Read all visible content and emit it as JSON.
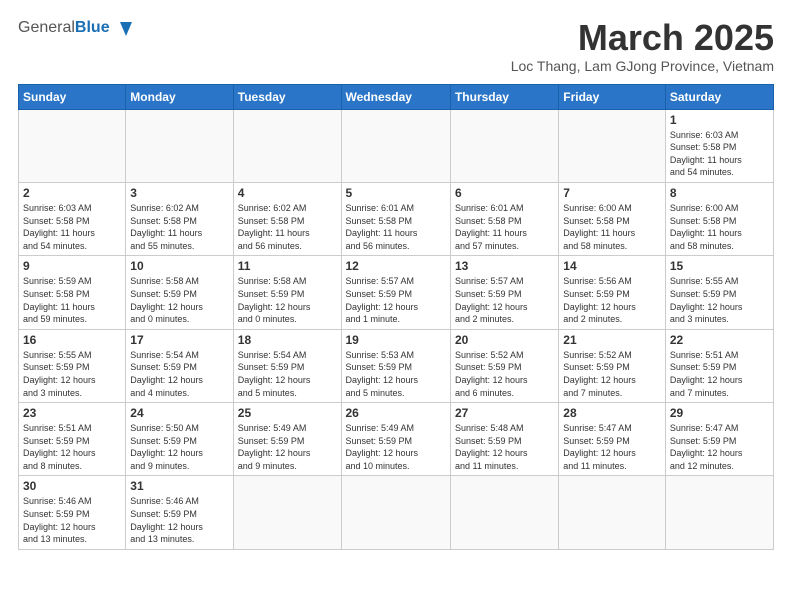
{
  "header": {
    "logo_general": "General",
    "logo_blue": "Blue",
    "month_title": "March 2025",
    "subtitle": "Loc Thang, Lam GJong Province, Vietnam"
  },
  "weekdays": [
    "Sunday",
    "Monday",
    "Tuesday",
    "Wednesday",
    "Thursday",
    "Friday",
    "Saturday"
  ],
  "weeks": [
    [
      {
        "day": null,
        "info": null
      },
      {
        "day": null,
        "info": null
      },
      {
        "day": null,
        "info": null
      },
      {
        "day": null,
        "info": null
      },
      {
        "day": null,
        "info": null
      },
      {
        "day": null,
        "info": null
      },
      {
        "day": "1",
        "info": "Sunrise: 6:03 AM\nSunset: 5:58 PM\nDaylight: 11 hours\nand 54 minutes."
      }
    ],
    [
      {
        "day": "2",
        "info": "Sunrise: 6:03 AM\nSunset: 5:58 PM\nDaylight: 11 hours\nand 54 minutes."
      },
      {
        "day": "3",
        "info": "Sunrise: 6:02 AM\nSunset: 5:58 PM\nDaylight: 11 hours\nand 55 minutes."
      },
      {
        "day": "4",
        "info": "Sunrise: 6:02 AM\nSunset: 5:58 PM\nDaylight: 11 hours\nand 56 minutes."
      },
      {
        "day": "5",
        "info": "Sunrise: 6:01 AM\nSunset: 5:58 PM\nDaylight: 11 hours\nand 56 minutes."
      },
      {
        "day": "6",
        "info": "Sunrise: 6:01 AM\nSunset: 5:58 PM\nDaylight: 11 hours\nand 57 minutes."
      },
      {
        "day": "7",
        "info": "Sunrise: 6:00 AM\nSunset: 5:58 PM\nDaylight: 11 hours\nand 58 minutes."
      },
      {
        "day": "8",
        "info": "Sunrise: 6:00 AM\nSunset: 5:58 PM\nDaylight: 11 hours\nand 58 minutes."
      }
    ],
    [
      {
        "day": "9",
        "info": "Sunrise: 5:59 AM\nSunset: 5:58 PM\nDaylight: 11 hours\nand 59 minutes."
      },
      {
        "day": "10",
        "info": "Sunrise: 5:58 AM\nSunset: 5:59 PM\nDaylight: 12 hours\nand 0 minutes."
      },
      {
        "day": "11",
        "info": "Sunrise: 5:58 AM\nSunset: 5:59 PM\nDaylight: 12 hours\nand 0 minutes."
      },
      {
        "day": "12",
        "info": "Sunrise: 5:57 AM\nSunset: 5:59 PM\nDaylight: 12 hours\nand 1 minute."
      },
      {
        "day": "13",
        "info": "Sunrise: 5:57 AM\nSunset: 5:59 PM\nDaylight: 12 hours\nand 2 minutes."
      },
      {
        "day": "14",
        "info": "Sunrise: 5:56 AM\nSunset: 5:59 PM\nDaylight: 12 hours\nand 2 minutes."
      },
      {
        "day": "15",
        "info": "Sunrise: 5:55 AM\nSunset: 5:59 PM\nDaylight: 12 hours\nand 3 minutes."
      }
    ],
    [
      {
        "day": "16",
        "info": "Sunrise: 5:55 AM\nSunset: 5:59 PM\nDaylight: 12 hours\nand 3 minutes."
      },
      {
        "day": "17",
        "info": "Sunrise: 5:54 AM\nSunset: 5:59 PM\nDaylight: 12 hours\nand 4 minutes."
      },
      {
        "day": "18",
        "info": "Sunrise: 5:54 AM\nSunset: 5:59 PM\nDaylight: 12 hours\nand 5 minutes."
      },
      {
        "day": "19",
        "info": "Sunrise: 5:53 AM\nSunset: 5:59 PM\nDaylight: 12 hours\nand 5 minutes."
      },
      {
        "day": "20",
        "info": "Sunrise: 5:52 AM\nSunset: 5:59 PM\nDaylight: 12 hours\nand 6 minutes."
      },
      {
        "day": "21",
        "info": "Sunrise: 5:52 AM\nSunset: 5:59 PM\nDaylight: 12 hours\nand 7 minutes."
      },
      {
        "day": "22",
        "info": "Sunrise: 5:51 AM\nSunset: 5:59 PM\nDaylight: 12 hours\nand 7 minutes."
      }
    ],
    [
      {
        "day": "23",
        "info": "Sunrise: 5:51 AM\nSunset: 5:59 PM\nDaylight: 12 hours\nand 8 minutes."
      },
      {
        "day": "24",
        "info": "Sunrise: 5:50 AM\nSunset: 5:59 PM\nDaylight: 12 hours\nand 9 minutes."
      },
      {
        "day": "25",
        "info": "Sunrise: 5:49 AM\nSunset: 5:59 PM\nDaylight: 12 hours\nand 9 minutes."
      },
      {
        "day": "26",
        "info": "Sunrise: 5:49 AM\nSunset: 5:59 PM\nDaylight: 12 hours\nand 10 minutes."
      },
      {
        "day": "27",
        "info": "Sunrise: 5:48 AM\nSunset: 5:59 PM\nDaylight: 12 hours\nand 11 minutes."
      },
      {
        "day": "28",
        "info": "Sunrise: 5:47 AM\nSunset: 5:59 PM\nDaylight: 12 hours\nand 11 minutes."
      },
      {
        "day": "29",
        "info": "Sunrise: 5:47 AM\nSunset: 5:59 PM\nDaylight: 12 hours\nand 12 minutes."
      }
    ],
    [
      {
        "day": "30",
        "info": "Sunrise: 5:46 AM\nSunset: 5:59 PM\nDaylight: 12 hours\nand 13 minutes."
      },
      {
        "day": "31",
        "info": "Sunrise: 5:46 AM\nSunset: 5:59 PM\nDaylight: 12 hours\nand 13 minutes."
      },
      {
        "day": null,
        "info": null
      },
      {
        "day": null,
        "info": null
      },
      {
        "day": null,
        "info": null
      },
      {
        "day": null,
        "info": null
      },
      {
        "day": null,
        "info": null
      }
    ]
  ]
}
